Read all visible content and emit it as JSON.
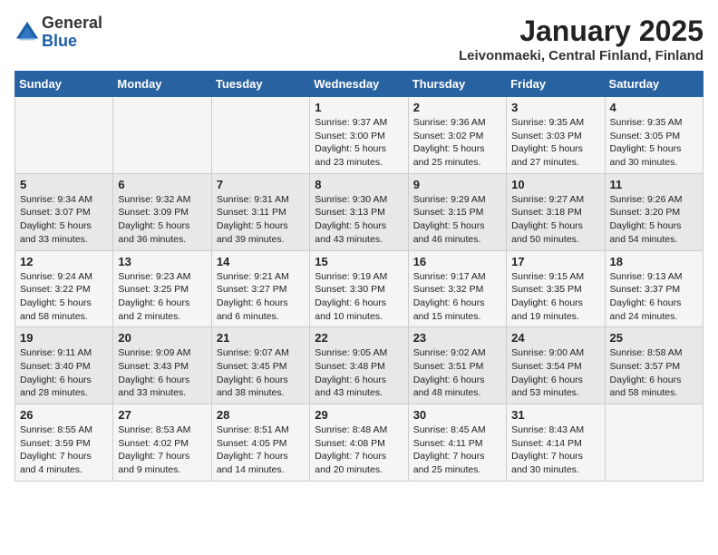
{
  "logo": {
    "general": "General",
    "blue": "Blue"
  },
  "title": "January 2025",
  "subtitle": "Leivonmaeki, Central Finland, Finland",
  "weekdays": [
    "Sunday",
    "Monday",
    "Tuesday",
    "Wednesday",
    "Thursday",
    "Friday",
    "Saturday"
  ],
  "weeks": [
    [
      {
        "day": "",
        "sunrise": "",
        "sunset": "",
        "daylight": ""
      },
      {
        "day": "",
        "sunrise": "",
        "sunset": "",
        "daylight": ""
      },
      {
        "day": "",
        "sunrise": "",
        "sunset": "",
        "daylight": ""
      },
      {
        "day": "1",
        "sunrise": "Sunrise: 9:37 AM",
        "sunset": "Sunset: 3:00 PM",
        "daylight": "Daylight: 5 hours and 23 minutes."
      },
      {
        "day": "2",
        "sunrise": "Sunrise: 9:36 AM",
        "sunset": "Sunset: 3:02 PM",
        "daylight": "Daylight: 5 hours and 25 minutes."
      },
      {
        "day": "3",
        "sunrise": "Sunrise: 9:35 AM",
        "sunset": "Sunset: 3:03 PM",
        "daylight": "Daylight: 5 hours and 27 minutes."
      },
      {
        "day": "4",
        "sunrise": "Sunrise: 9:35 AM",
        "sunset": "Sunset: 3:05 PM",
        "daylight": "Daylight: 5 hours and 30 minutes."
      }
    ],
    [
      {
        "day": "5",
        "sunrise": "Sunrise: 9:34 AM",
        "sunset": "Sunset: 3:07 PM",
        "daylight": "Daylight: 5 hours and 33 minutes."
      },
      {
        "day": "6",
        "sunrise": "Sunrise: 9:32 AM",
        "sunset": "Sunset: 3:09 PM",
        "daylight": "Daylight: 5 hours and 36 minutes."
      },
      {
        "day": "7",
        "sunrise": "Sunrise: 9:31 AM",
        "sunset": "Sunset: 3:11 PM",
        "daylight": "Daylight: 5 hours and 39 minutes."
      },
      {
        "day": "8",
        "sunrise": "Sunrise: 9:30 AM",
        "sunset": "Sunset: 3:13 PM",
        "daylight": "Daylight: 5 hours and 43 minutes."
      },
      {
        "day": "9",
        "sunrise": "Sunrise: 9:29 AM",
        "sunset": "Sunset: 3:15 PM",
        "daylight": "Daylight: 5 hours and 46 minutes."
      },
      {
        "day": "10",
        "sunrise": "Sunrise: 9:27 AM",
        "sunset": "Sunset: 3:18 PM",
        "daylight": "Daylight: 5 hours and 50 minutes."
      },
      {
        "day": "11",
        "sunrise": "Sunrise: 9:26 AM",
        "sunset": "Sunset: 3:20 PM",
        "daylight": "Daylight: 5 hours and 54 minutes."
      }
    ],
    [
      {
        "day": "12",
        "sunrise": "Sunrise: 9:24 AM",
        "sunset": "Sunset: 3:22 PM",
        "daylight": "Daylight: 5 hours and 58 minutes."
      },
      {
        "day": "13",
        "sunrise": "Sunrise: 9:23 AM",
        "sunset": "Sunset: 3:25 PM",
        "daylight": "Daylight: 6 hours and 2 minutes."
      },
      {
        "day": "14",
        "sunrise": "Sunrise: 9:21 AM",
        "sunset": "Sunset: 3:27 PM",
        "daylight": "Daylight: 6 hours and 6 minutes."
      },
      {
        "day": "15",
        "sunrise": "Sunrise: 9:19 AM",
        "sunset": "Sunset: 3:30 PM",
        "daylight": "Daylight: 6 hours and 10 minutes."
      },
      {
        "day": "16",
        "sunrise": "Sunrise: 9:17 AM",
        "sunset": "Sunset: 3:32 PM",
        "daylight": "Daylight: 6 hours and 15 minutes."
      },
      {
        "day": "17",
        "sunrise": "Sunrise: 9:15 AM",
        "sunset": "Sunset: 3:35 PM",
        "daylight": "Daylight: 6 hours and 19 minutes."
      },
      {
        "day": "18",
        "sunrise": "Sunrise: 9:13 AM",
        "sunset": "Sunset: 3:37 PM",
        "daylight": "Daylight: 6 hours and 24 minutes."
      }
    ],
    [
      {
        "day": "19",
        "sunrise": "Sunrise: 9:11 AM",
        "sunset": "Sunset: 3:40 PM",
        "daylight": "Daylight: 6 hours and 28 minutes."
      },
      {
        "day": "20",
        "sunrise": "Sunrise: 9:09 AM",
        "sunset": "Sunset: 3:43 PM",
        "daylight": "Daylight: 6 hours and 33 minutes."
      },
      {
        "day": "21",
        "sunrise": "Sunrise: 9:07 AM",
        "sunset": "Sunset: 3:45 PM",
        "daylight": "Daylight: 6 hours and 38 minutes."
      },
      {
        "day": "22",
        "sunrise": "Sunrise: 9:05 AM",
        "sunset": "Sunset: 3:48 PM",
        "daylight": "Daylight: 6 hours and 43 minutes."
      },
      {
        "day": "23",
        "sunrise": "Sunrise: 9:02 AM",
        "sunset": "Sunset: 3:51 PM",
        "daylight": "Daylight: 6 hours and 48 minutes."
      },
      {
        "day": "24",
        "sunrise": "Sunrise: 9:00 AM",
        "sunset": "Sunset: 3:54 PM",
        "daylight": "Daylight: 6 hours and 53 minutes."
      },
      {
        "day": "25",
        "sunrise": "Sunrise: 8:58 AM",
        "sunset": "Sunset: 3:57 PM",
        "daylight": "Daylight: 6 hours and 58 minutes."
      }
    ],
    [
      {
        "day": "26",
        "sunrise": "Sunrise: 8:55 AM",
        "sunset": "Sunset: 3:59 PM",
        "daylight": "Daylight: 7 hours and 4 minutes."
      },
      {
        "day": "27",
        "sunrise": "Sunrise: 8:53 AM",
        "sunset": "Sunset: 4:02 PM",
        "daylight": "Daylight: 7 hours and 9 minutes."
      },
      {
        "day": "28",
        "sunrise": "Sunrise: 8:51 AM",
        "sunset": "Sunset: 4:05 PM",
        "daylight": "Daylight: 7 hours and 14 minutes."
      },
      {
        "day": "29",
        "sunrise": "Sunrise: 8:48 AM",
        "sunset": "Sunset: 4:08 PM",
        "daylight": "Daylight: 7 hours and 20 minutes."
      },
      {
        "day": "30",
        "sunrise": "Sunrise: 8:45 AM",
        "sunset": "Sunset: 4:11 PM",
        "daylight": "Daylight: 7 hours and 25 minutes."
      },
      {
        "day": "31",
        "sunrise": "Sunrise: 8:43 AM",
        "sunset": "Sunset: 4:14 PM",
        "daylight": "Daylight: 7 hours and 30 minutes."
      },
      {
        "day": "",
        "sunrise": "",
        "sunset": "",
        "daylight": ""
      }
    ]
  ]
}
